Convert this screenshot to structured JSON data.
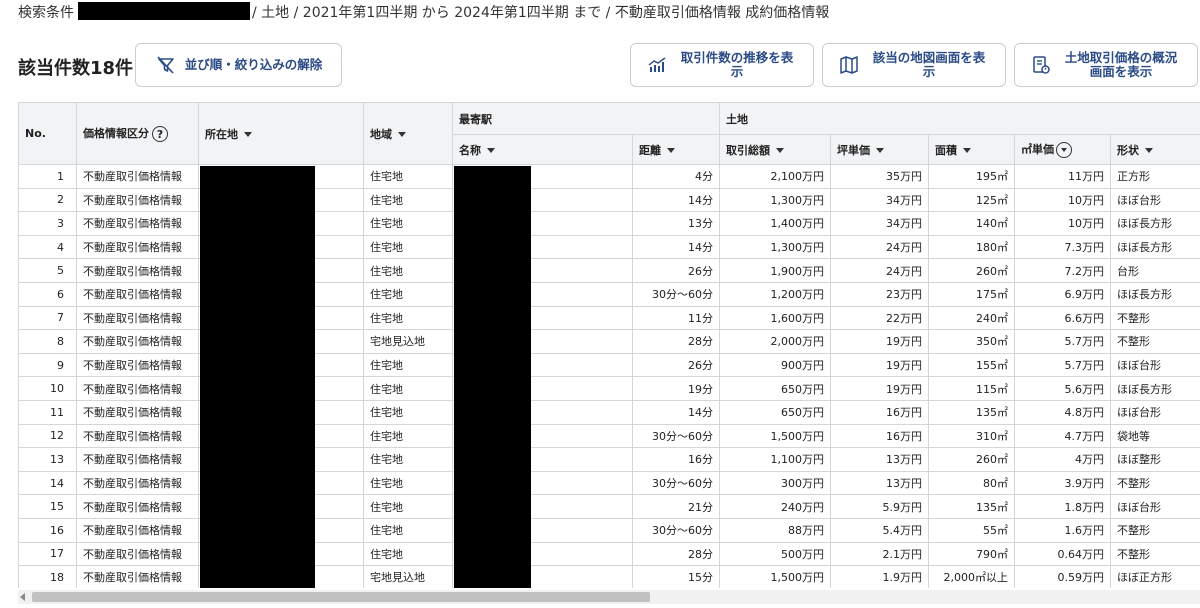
{
  "breadcrumb": {
    "prefix": "検索条件",
    "rest": "/ 土地 / 2021年第1四半期 から 2024年第1四半期 まで / 不動産取引価格情報 成約価格情報"
  },
  "result_count": "該当件数18件",
  "buttons": {
    "reset": "並び順・絞り込みの解除",
    "trend": "取引件数の推移を表示",
    "map": "該当の地図画面を表示",
    "overview": "土地取引価格の概況画面を表示"
  },
  "table": {
    "group_headers": {
      "station": "最寄駅",
      "land": "土地"
    },
    "headers": {
      "no": "No.",
      "info_type": "価格情報区分",
      "location": "所在地",
      "area_type": "地域",
      "station_name": "名称",
      "distance": "距離",
      "total": "取引総額",
      "tsubo_price": "坪単価",
      "size": "面積",
      "sqm_price": "㎡単価",
      "shape": "形状"
    },
    "rows": [
      {
        "no": "1",
        "info": "不動産取引価格情報",
        "area": "住宅地",
        "dist": "4分",
        "total": "2,100万円",
        "tsubo": "35万円",
        "size": "195㎡",
        "sqm": "11万円",
        "shape": "正方形"
      },
      {
        "no": "2",
        "info": "不動産取引価格情報",
        "area": "住宅地",
        "dist": "14分",
        "total": "1,300万円",
        "tsubo": "34万円",
        "size": "125㎡",
        "sqm": "10万円",
        "shape": "ほぼ台形"
      },
      {
        "no": "3",
        "info": "不動産取引価格情報",
        "area": "住宅地",
        "dist": "13分",
        "total": "1,400万円",
        "tsubo": "34万円",
        "size": "140㎡",
        "sqm": "10万円",
        "shape": "ほぼ長方形"
      },
      {
        "no": "4",
        "info": "不動産取引価格情報",
        "area": "住宅地",
        "dist": "14分",
        "total": "1,300万円",
        "tsubo": "24万円",
        "size": "180㎡",
        "sqm": "7.3万円",
        "shape": "ほぼ長方形"
      },
      {
        "no": "5",
        "info": "不動産取引価格情報",
        "area": "住宅地",
        "dist": "26分",
        "total": "1,900万円",
        "tsubo": "24万円",
        "size": "260㎡",
        "sqm": "7.2万円",
        "shape": "台形"
      },
      {
        "no": "6",
        "info": "不動産取引価格情報",
        "area": "住宅地",
        "dist": "30分〜60分",
        "total": "1,200万円",
        "tsubo": "23万円",
        "size": "175㎡",
        "sqm": "6.9万円",
        "shape": "ほぼ長方形"
      },
      {
        "no": "7",
        "info": "不動産取引価格情報",
        "area": "住宅地",
        "dist": "11分",
        "total": "1,600万円",
        "tsubo": "22万円",
        "size": "240㎡",
        "sqm": "6.6万円",
        "shape": "不整形"
      },
      {
        "no": "8",
        "info": "不動産取引価格情報",
        "area": "宅地見込地",
        "dist": "28分",
        "total": "2,000万円",
        "tsubo": "19万円",
        "size": "350㎡",
        "sqm": "5.7万円",
        "shape": "不整形"
      },
      {
        "no": "9",
        "info": "不動産取引価格情報",
        "area": "住宅地",
        "dist": "26分",
        "total": "900万円",
        "tsubo": "19万円",
        "size": "155㎡",
        "sqm": "5.7万円",
        "shape": "ほぼ台形"
      },
      {
        "no": "10",
        "info": "不動産取引価格情報",
        "area": "住宅地",
        "dist": "19分",
        "total": "650万円",
        "tsubo": "19万円",
        "size": "115㎡",
        "sqm": "5.6万円",
        "shape": "ほぼ長方形"
      },
      {
        "no": "11",
        "info": "不動産取引価格情報",
        "area": "住宅地",
        "dist": "14分",
        "total": "650万円",
        "tsubo": "16万円",
        "size": "135㎡",
        "sqm": "4.8万円",
        "shape": "ほぼ台形"
      },
      {
        "no": "12",
        "info": "不動産取引価格情報",
        "area": "住宅地",
        "dist": "30分〜60分",
        "total": "1,500万円",
        "tsubo": "16万円",
        "size": "310㎡",
        "sqm": "4.7万円",
        "shape": "袋地等"
      },
      {
        "no": "13",
        "info": "不動産取引価格情報",
        "area": "住宅地",
        "dist": "16分",
        "total": "1,100万円",
        "tsubo": "13万円",
        "size": "260㎡",
        "sqm": "4万円",
        "shape": "ほぼ整形"
      },
      {
        "no": "14",
        "info": "不動産取引価格情報",
        "area": "住宅地",
        "dist": "30分〜60分",
        "total": "300万円",
        "tsubo": "13万円",
        "size": "80㎡",
        "sqm": "3.9万円",
        "shape": "不整形"
      },
      {
        "no": "15",
        "info": "不動産取引価格情報",
        "area": "住宅地",
        "dist": "21分",
        "total": "240万円",
        "tsubo": "5.9万円",
        "size": "135㎡",
        "sqm": "1.8万円",
        "shape": "ほぼ台形"
      },
      {
        "no": "16",
        "info": "不動産取引価格情報",
        "area": "住宅地",
        "dist": "30分〜60分",
        "total": "88万円",
        "tsubo": "5.4万円",
        "size": "55㎡",
        "sqm": "1.6万円",
        "shape": "不整形"
      },
      {
        "no": "17",
        "info": "不動産取引価格情報",
        "area": "住宅地",
        "dist": "28分",
        "total": "500万円",
        "tsubo": "2.1万円",
        "size": "790㎡",
        "sqm": "0.64万円",
        "shape": "不整形"
      },
      {
        "no": "18",
        "info": "不動産取引価格情報",
        "area": "宅地見込地",
        "dist": "15分",
        "total": "1,500万円",
        "tsubo": "1.9万円",
        "size": "2,000㎡以上",
        "sqm": "0.59万円",
        "shape": "ほぼ正方形"
      }
    ]
  },
  "colors": {
    "accent": "#2b4b86",
    "header_bg": "#f2f3f5",
    "border": "#d3d6da"
  }
}
